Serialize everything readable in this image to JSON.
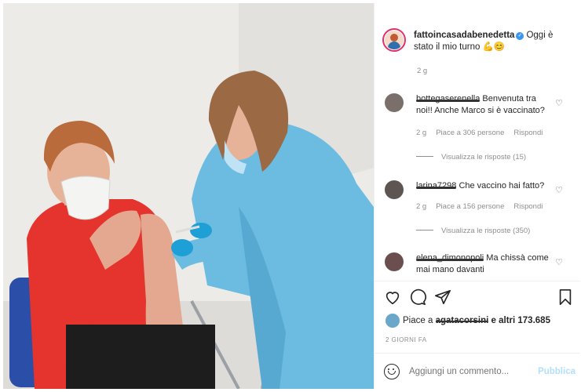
{
  "post": {
    "username": "fattoincasadabenedetta",
    "caption": "Oggi è stato il mio turno",
    "caption_emojis": "💪😊",
    "time": "2 g"
  },
  "comments": [
    {
      "user": "bottegaserenella",
      "text": "Benvenuta tra noi!! Anche Marco si è vaccinato?",
      "time": "2 g",
      "likes": "Piace a 306 persone",
      "reply": "Rispondi",
      "view_replies": "Visualizza le risposte (15)"
    },
    {
      "user": "larina7298",
      "text": "Che vaccino hai fatto?",
      "time": "2 g",
      "likes": "Piace a 156 persone",
      "reply": "Rispondi",
      "view_replies": "Visualizza le risposte (350)"
    },
    {
      "user": "elena_dimonopoli",
      "text": "Ma chissà come mai mano davanti"
    }
  ],
  "likes": {
    "prefix": "Piace a",
    "user": "agatacorsini",
    "suffix": "e altri 173.685"
  },
  "date": "2 GIORNI FA",
  "add_comment": {
    "placeholder": "Aggiungi un commento...",
    "publish": "Pubblica"
  },
  "icons": [
    "heart-icon",
    "comment-icon",
    "share-icon",
    "bookmark-icon",
    "emoji-icon",
    "verified-icon"
  ]
}
